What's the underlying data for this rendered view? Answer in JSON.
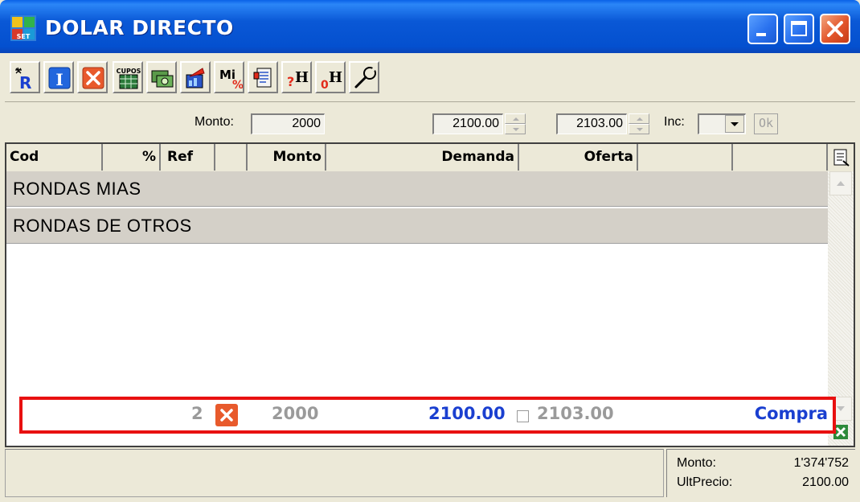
{
  "window": {
    "title": "DOLAR DIRECTO",
    "app_icon": "dolar-directo-logo-icon",
    "controls": [
      "minimize-icon",
      "maximize-icon",
      "close-icon"
    ],
    "colors": {
      "titlebar": "#0a58d6",
      "close": "#e2552b"
    }
  },
  "toolbar": {
    "buttons": [
      {
        "name": "r-sparkle-button",
        "icon": "r-sparkle-icon",
        "label": "R"
      },
      {
        "name": "info-button",
        "icon": "info-i-icon",
        "label": "I"
      },
      {
        "name": "cancel-button",
        "icon": "red-x-icon"
      },
      {
        "name": "cupos-button",
        "icon": "cupos-grid-icon",
        "label": "CUPOS"
      },
      {
        "name": "cash-button",
        "icon": "cash-notes-icon"
      },
      {
        "name": "chart-button",
        "icon": "chart-arrow-icon"
      },
      {
        "name": "mis-percent-button",
        "icon": "mi-percent-icon",
        "label": "Mi",
        "sub": "%"
      },
      {
        "name": "report-button",
        "icon": "report-list-icon"
      },
      {
        "name": "help-h-button",
        "icon": "question-h-icon",
        "label": "H",
        "prefix": "?"
      },
      {
        "name": "zero-h-button",
        "icon": "zero-h-icon",
        "label": "H",
        "prefix": "0"
      },
      {
        "name": "tools-button",
        "icon": "wrench-icon"
      }
    ]
  },
  "inputbar": {
    "monto_label": "Monto:",
    "monto_value": "2000",
    "demanda_price": "2100.00",
    "oferta_price": "2103.00",
    "inc_label": "Inc:",
    "inc_value": "",
    "ok_label": "Ok"
  },
  "grid": {
    "columns": [
      "Cod",
      "%",
      "Ref",
      "Monto",
      "Demanda",
      "Oferta"
    ],
    "groups": [
      "RONDAS MIAS",
      "RONDAS DE OTROS"
    ],
    "rows": [
      {
        "pct": "2",
        "monto": "2000",
        "demanda": "2100.00",
        "oferta": "2103.00",
        "tipo": "Compra"
      }
    ],
    "colors": {
      "highlight": "#e81010",
      "demanda": "#1a3fd0",
      "gray": "#9a9a9a",
      "compra": "#1a3fd0"
    }
  },
  "status": {
    "monto_label": "Monto:",
    "monto_value": "1'374'752",
    "ultprecio_label": "UltPrecio:",
    "ultprecio_value": "2100.00"
  }
}
